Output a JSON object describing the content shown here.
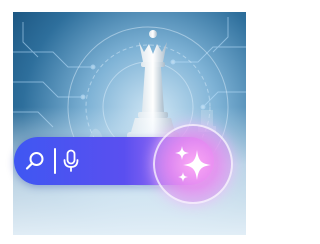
{
  "scene": {
    "background": "chess-queen-tech-circuit",
    "accent_colors": [
      "#3f57f2",
      "#9b6ef3",
      "#e88cf0"
    ]
  },
  "search_bar": {
    "search_icon": "search-icon",
    "mic_icon": "microphone-icon",
    "ai_button_icon": "sparkles-icon"
  }
}
